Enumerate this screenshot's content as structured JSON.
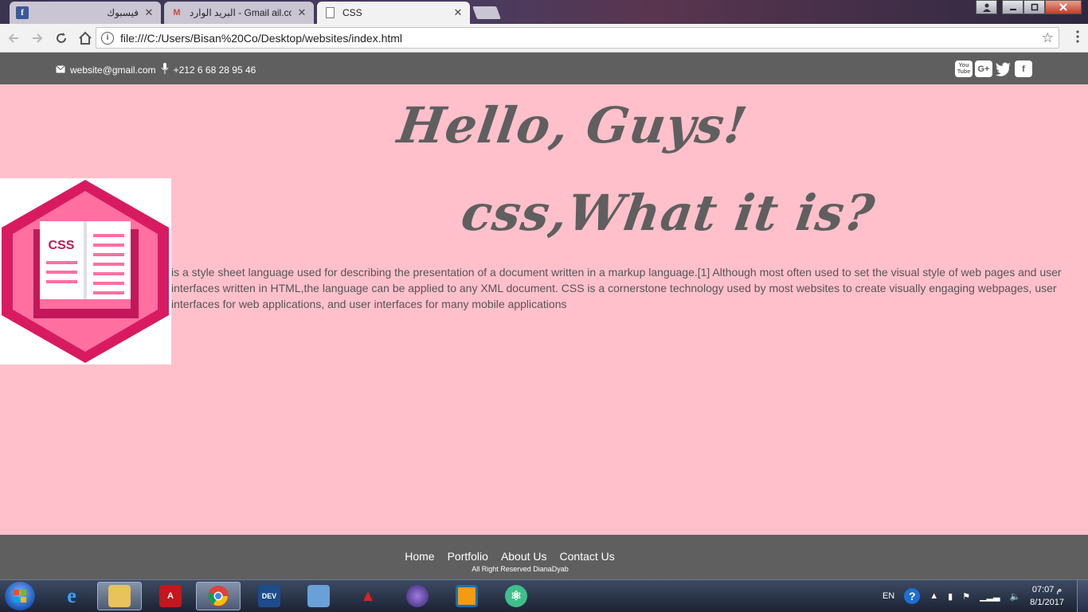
{
  "browser": {
    "tabs": [
      {
        "title": "فيسبوك",
        "favicon": "facebook-icon"
      },
      {
        "title": "البريد الوارد - Gmail ail.com",
        "favicon": "gmail-icon"
      },
      {
        "title": "CSS",
        "favicon": "document-icon"
      }
    ],
    "close_glyph": "✕",
    "address": "file:///C:/Users/Bisan%20Co/Desktop/websites/index.html"
  },
  "page": {
    "topbar": {
      "email": "website@gmail.com",
      "phone": "+212 6 68 28 95 46",
      "social": [
        "You Tube",
        "G+",
        "twitter",
        "f"
      ]
    },
    "heading": "Hello, Guys!",
    "subheading": "css,What it is?",
    "logo_label": "CSS",
    "description": "is a style sheet language used for describing the presentation of a document written in a markup language.[1] Although most often used to set the visual style of web pages and user interfaces written in HTML,the language can be applied to any XML document. CSS is a cornerstone technology used by most websites to create visually engaging webpages, user interfaces for web applications, and user interfaces for many mobile applications",
    "footer": {
      "links": [
        "Home",
        "Portfolio",
        "About Us",
        "Contact Us"
      ],
      "rights": "All Right Reserved DianaDyab"
    },
    "colors": {
      "background": "#ffc0cb",
      "bar": "#5f5f5f",
      "logo_pink": "#d81b60"
    }
  },
  "taskbar": {
    "apps": [
      "internet-explorer",
      "file-explorer",
      "adobe-reader",
      "chrome",
      "dev-cpp",
      "media-app",
      "acrobat-app",
      "eclipse",
      "vmware",
      "atom"
    ],
    "language": "EN",
    "time": "07:07 م",
    "date": "8/1/2017"
  }
}
